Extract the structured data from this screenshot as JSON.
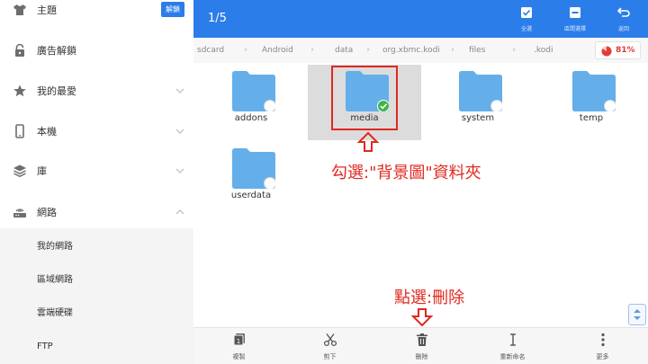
{
  "sidebar": {
    "theme": {
      "label": "主題",
      "badge": "解鎖"
    },
    "items": [
      {
        "label": "廣告解鎖"
      },
      {
        "label": "我的最愛"
      },
      {
        "label": "本機"
      },
      {
        "label": "庫"
      },
      {
        "label": "網路"
      }
    ],
    "network_children": [
      {
        "label": "我的網路"
      },
      {
        "label": "區域網路"
      },
      {
        "label": "雲端硬碟"
      },
      {
        "label": "FTP"
      }
    ]
  },
  "topbar": {
    "counter": "1/5",
    "select_all": "全選",
    "interval_select": "區間選擇",
    "back": "返回",
    "accent_color": "#2b7de9"
  },
  "breadcrumb": {
    "segments": [
      "sdcard",
      "Android",
      "data",
      "org.xbmc.kodi",
      "files",
      ".kodi"
    ],
    "storage_percent": "81%"
  },
  "files": [
    {
      "name": "addons",
      "selected": false
    },
    {
      "name": "media",
      "selected": true
    },
    {
      "name": "system",
      "selected": false
    },
    {
      "name": "temp",
      "selected": false
    },
    {
      "name": "userdata",
      "selected": false
    }
  ],
  "annotations": {
    "select_folder": "勾選:\"背景圖\"資料夾",
    "tap_delete": "點選:刪除"
  },
  "bottombar": {
    "copy": "複製",
    "cut": "剪下",
    "delete": "刪除",
    "rename": "重新命名",
    "more": "更多"
  },
  "icons": {
    "theme": "shirt-icon",
    "ad_unlock": "lock-icon",
    "favorites": "star-icon",
    "local": "phone-icon",
    "library": "layers-icon",
    "network": "router-icon",
    "folder": "folder-icon",
    "check": "check-circle-icon"
  }
}
